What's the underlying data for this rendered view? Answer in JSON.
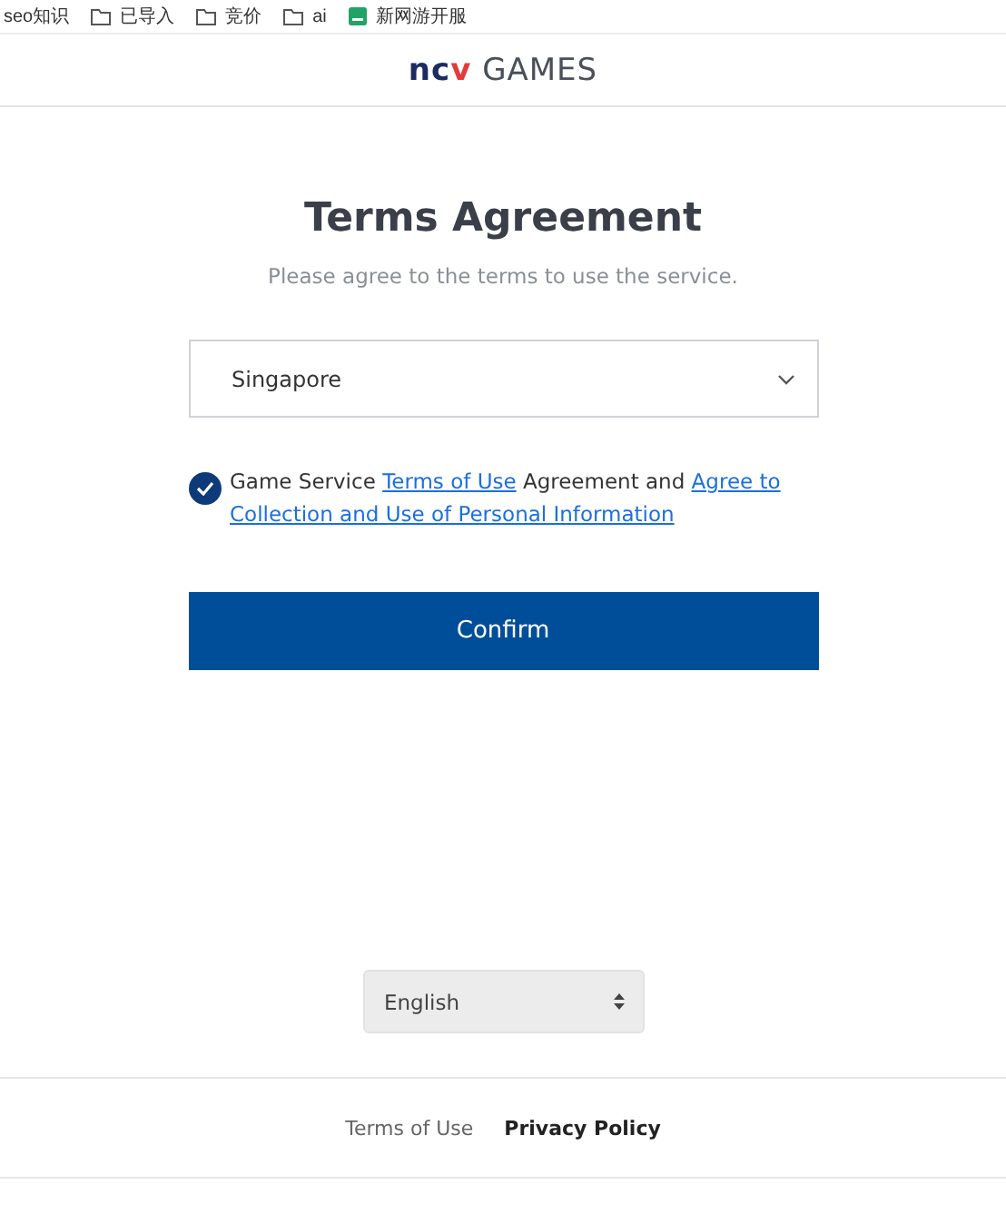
{
  "bookmarks": [
    {
      "kind": "plain",
      "label": "seo知识"
    },
    {
      "kind": "folder",
      "label": "已导入"
    },
    {
      "kind": "folder",
      "label": "竞价"
    },
    {
      "kind": "folder",
      "label": "ai"
    },
    {
      "kind": "app",
      "label": "新网游开服"
    }
  ],
  "logo": [
    {
      "text": "nc",
      "color": "#1b2b63"
    },
    {
      "text": "v",
      "color": "#e23b3b"
    },
    {
      "text": " GAMES",
      "color": "#4a4f5a"
    }
  ],
  "title": "Terms Agreement",
  "subtitle": "Please agree to the terms to use the service.",
  "country_select": {
    "value": "Singapore"
  },
  "agreement": {
    "checked": true,
    "parts": [
      {
        "text": "Game Service ",
        "link": false
      },
      {
        "text": "Terms of Use",
        "link": true
      },
      {
        "text": " Agreement and ",
        "link": false
      },
      {
        "text": "Agree to",
        "link": true
      },
      {
        "text": "Collection and Use of Personal Information",
        "link": true
      }
    ]
  },
  "confirm_button": "Confirm",
  "language_select": {
    "value": "English"
  },
  "footer_links": [
    {
      "label": "Terms of Use",
      "bold": false
    },
    {
      "label": "Privacy Policy",
      "bold": true
    }
  ]
}
